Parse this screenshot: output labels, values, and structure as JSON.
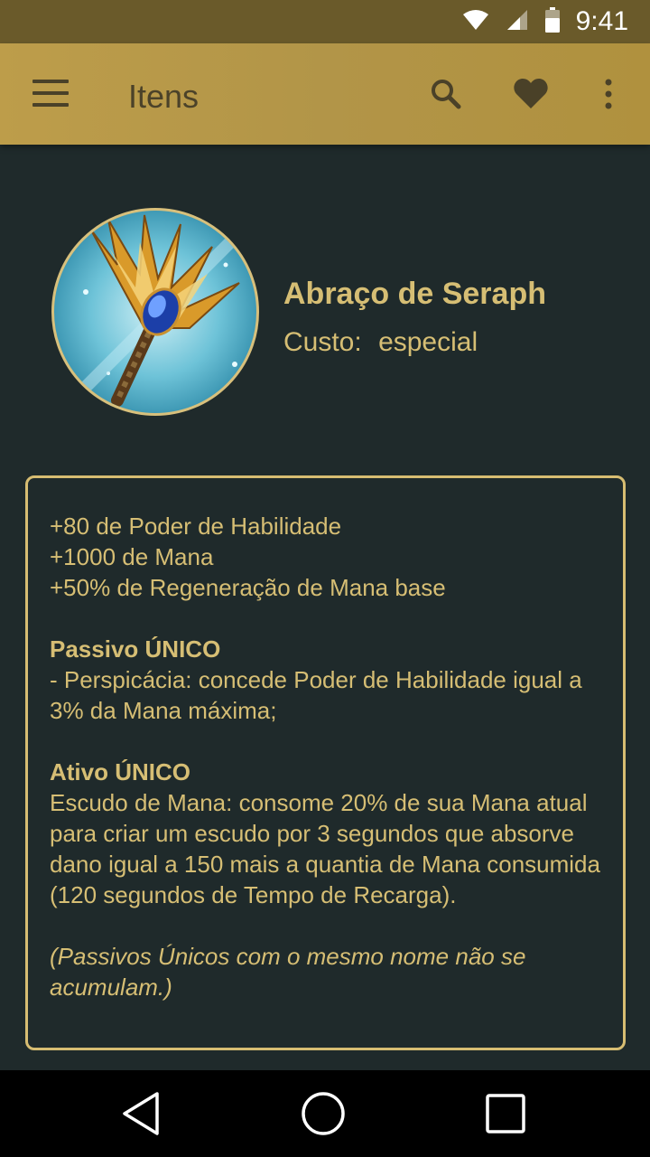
{
  "status_bar": {
    "time": "9:41",
    "icons": [
      "wifi-icon",
      "signal-icon",
      "battery-icon"
    ]
  },
  "app_bar": {
    "title": "Itens",
    "actions": [
      "menu-icon",
      "search-icon",
      "heart-icon",
      "more-vert-icon"
    ]
  },
  "item": {
    "name": "Abraço de Seraph",
    "cost_label": "Custo:",
    "cost_value": "especial",
    "image_icon": "seraph-embrace-item-image"
  },
  "description": {
    "stats": [
      "+80 de Poder de Habilidade",
      "+1000 de Mana",
      "+50% de Regeneração de Mana base"
    ],
    "passive_title": "Passivo ÚNICO",
    "passive_text": "- Perspicácia: concede Poder de Habilidade igual a 3% da Mana máxima;",
    "active_title": "Ativo ÚNICO",
    "active_text": "Escudo de Mana: consome 20% de sua Mana atual para criar um escudo por 3 segundos que absorve dano igual a 150 mais a quantia de Mana consumida (120 segundos de Tempo de Recarga).",
    "note": "(Passivos Únicos com o mesmo nome não se acumulam.)"
  },
  "colors": {
    "background": "#1f2a2b",
    "app_bar": "#b29548",
    "status_bar": "#6a5a2a",
    "accent_text": "#d6be74"
  },
  "nav_bar": {
    "buttons": [
      "back-icon",
      "home-icon",
      "recents-icon"
    ]
  }
}
